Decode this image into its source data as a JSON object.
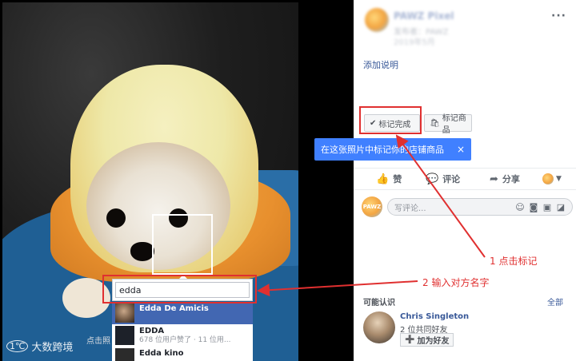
{
  "photo": {
    "tag_input_value": "edda",
    "hint_label": "点击照",
    "suggestions": [
      {
        "name": "Edda De Amicis",
        "meta": ""
      },
      {
        "name": "EDDA",
        "meta": "678 位用户赞了 · 11 位用..."
      },
      {
        "name": "Edda kino",
        "meta": ""
      }
    ],
    "watermark": "大数跨境",
    "watermark_logo": "1℃"
  },
  "panel": {
    "page_name": "PAWZ Pixel",
    "page_sub": "发布者：PAWZ",
    "page_sub2": "2019年5月",
    "more": "···",
    "add_description": "添加说明",
    "tag_done_label": "标记完成",
    "tag_product_label": "标记商品",
    "tooltip_text": "在这张照片中标记你的店铺商品",
    "tooltip_close": "×",
    "actions": {
      "like": "赞",
      "comment": "评论",
      "share": "分享"
    },
    "comment_avatar_text": "PAWZ",
    "comment_placeholder": "写评论...",
    "may_know": "可能认识",
    "see_all": "全部",
    "person": {
      "name": "Chris Singleton",
      "mutual": "2 位共同好友",
      "add_label": "加为好友"
    }
  },
  "annotations": {
    "step1": "1  点击标记",
    "step2": "2  输入对方名字",
    "color": "#e03030"
  },
  "colors": {
    "fb_blue": "#4267b2",
    "tooltip_blue": "#4080ff",
    "link": "#385898"
  }
}
